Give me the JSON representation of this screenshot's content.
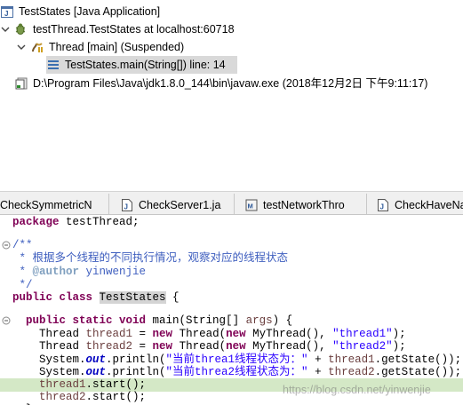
{
  "debug": {
    "launch": "TestStates [Java Application]",
    "target": "testThread.TestStates at localhost:60718",
    "thread": "Thread [main] (Suspended)",
    "frame": "TestStates.main(String[]) line: 14",
    "process": "D:\\Program Files\\Java\\jdk1.8.0_144\\bin\\javaw.exe (2018年12月2日 下午9:11:17)"
  },
  "tabs": [
    {
      "label": "CheckSymmetricN",
      "icon": "java-file-icon"
    },
    {
      "label": "CheckServer1.ja",
      "icon": "java-file-icon"
    },
    {
      "label": "testNetworkThro",
      "icon": "manifest-file-icon"
    },
    {
      "label": "CheckHaveNa",
      "icon": "java-file-icon"
    }
  ],
  "code": {
    "l1_kw": "package",
    "l1_rest": " testThread;",
    "l3": "/**",
    "l4": " * 根据多个线程的不同执行情况，观察对应的线程状态",
    "l5_pre": " * ",
    "l5_tag": "@author",
    "l5_post": " yinwenjie",
    "l6": " */",
    "l7_kw": "public class",
    "l7_sp": " ",
    "l7_name": "TestStates",
    "l7_post": " {",
    "l9_pre": "  ",
    "l9_kw": "public static void",
    "l9_post": " main(String[] ",
    "l9_var": "args",
    "l9_end": ") {",
    "l10_pre": "    Thread ",
    "l10_var": "thread1",
    "l10_mid": " = ",
    "l10_kw": "new",
    "l10_mid2": " Thread(",
    "l10_kw2": "new",
    "l10_mid3": " MyThread(), ",
    "l10_str": "\"thread1\"",
    "l10_end": ");",
    "l11_pre": "    Thread ",
    "l11_var": "thread2",
    "l11_mid": " = ",
    "l11_kw": "new",
    "l11_mid2": " Thread(",
    "l11_kw2": "new",
    "l11_mid3": " MyThread(), ",
    "l11_str": "\"thread2\"",
    "l11_end": ");",
    "l12_pre": "    System.",
    "l12_fld": "out",
    "l12_mid": ".println(",
    "l12_str": "\"当前threa1线程状态为：\"",
    "l12_mid2": " + ",
    "l12_var": "thread1",
    "l12_end": ".getState());",
    "l13_pre": "    System.",
    "l13_fld": "out",
    "l13_mid": ".println(",
    "l13_str": "\"当前threa2线程状态为：\"",
    "l13_mid2": " + ",
    "l13_var": "thread2",
    "l13_end": ".getState());",
    "l14_pre": "    ",
    "l14_var": "thread1",
    "l14_end": ".start();",
    "l15_pre": "    ",
    "l15_var": "thread2",
    "l15_end": ".start();",
    "l16": "  }"
  },
  "watermark": "https://blog.csdn.net/yinwenjie",
  "colors": {
    "keyword": "#7f0055",
    "string": "#2a00ff",
    "javadoc": "#3f5fbf",
    "current_line": "#d4e8c6"
  }
}
